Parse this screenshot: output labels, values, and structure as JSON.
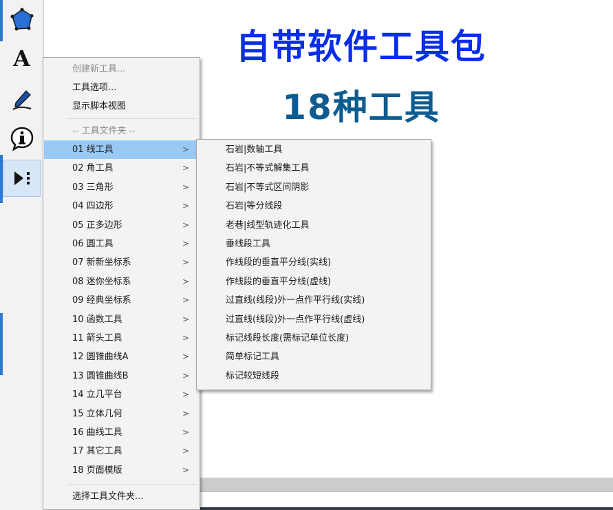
{
  "headline": {
    "line1": "自带软件工具包",
    "line2": "18种工具",
    "color1": "#0a2ee8",
    "color2": "#0d5c8f"
  },
  "toolbar": {
    "tools": [
      {
        "icon": "polygon-icon"
      },
      {
        "icon": "text-icon",
        "glyph": "A"
      },
      {
        "icon": "pen-icon"
      },
      {
        "icon": "info-icon",
        "glyph": "i"
      },
      {
        "icon": "custom-tool-icon"
      }
    ]
  },
  "main_menu": {
    "create_new_tool": "创建新工具...",
    "tool_options": "工具选项...",
    "show_script_view": "显示脚本视图",
    "folder_header": "-- 工具文件夹 --",
    "folders": [
      "01 线工具",
      "02 角工具",
      "03 三角形",
      "04 四边形",
      "05 正多边形",
      "06 圆工具",
      "07 新新坐标系",
      "08 迷你坐标系",
      "09 经典坐标系",
      "10 函数工具",
      "11 箭头工具",
      "12 圆锥曲线A",
      "13 圆锥曲线B",
      "14 立几平台",
      "15 立体几何",
      "16 曲线工具",
      "17 其它工具",
      "18 页面模版"
    ],
    "choose_folder": "选择工具文件夹...",
    "submenu_arrow": ">"
  },
  "submenu": {
    "items": [
      "石岩|数轴工具",
      "石岩|不等式解集工具",
      "石岩|不等式区间阴影",
      "石岩|等分线段",
      "老巷|线型轨迹化工具",
      "垂线段工具",
      "作线段的垂直平分线(实线)",
      "作线段的垂直平分线(虚线)",
      "过直线(线段)外一点作平行线(实线)",
      "过直线(线段)外一点作平行线(虚线)",
      "标记线段长度(需标记单位长度)",
      "简单标记工具",
      "标记较短线段"
    ]
  }
}
